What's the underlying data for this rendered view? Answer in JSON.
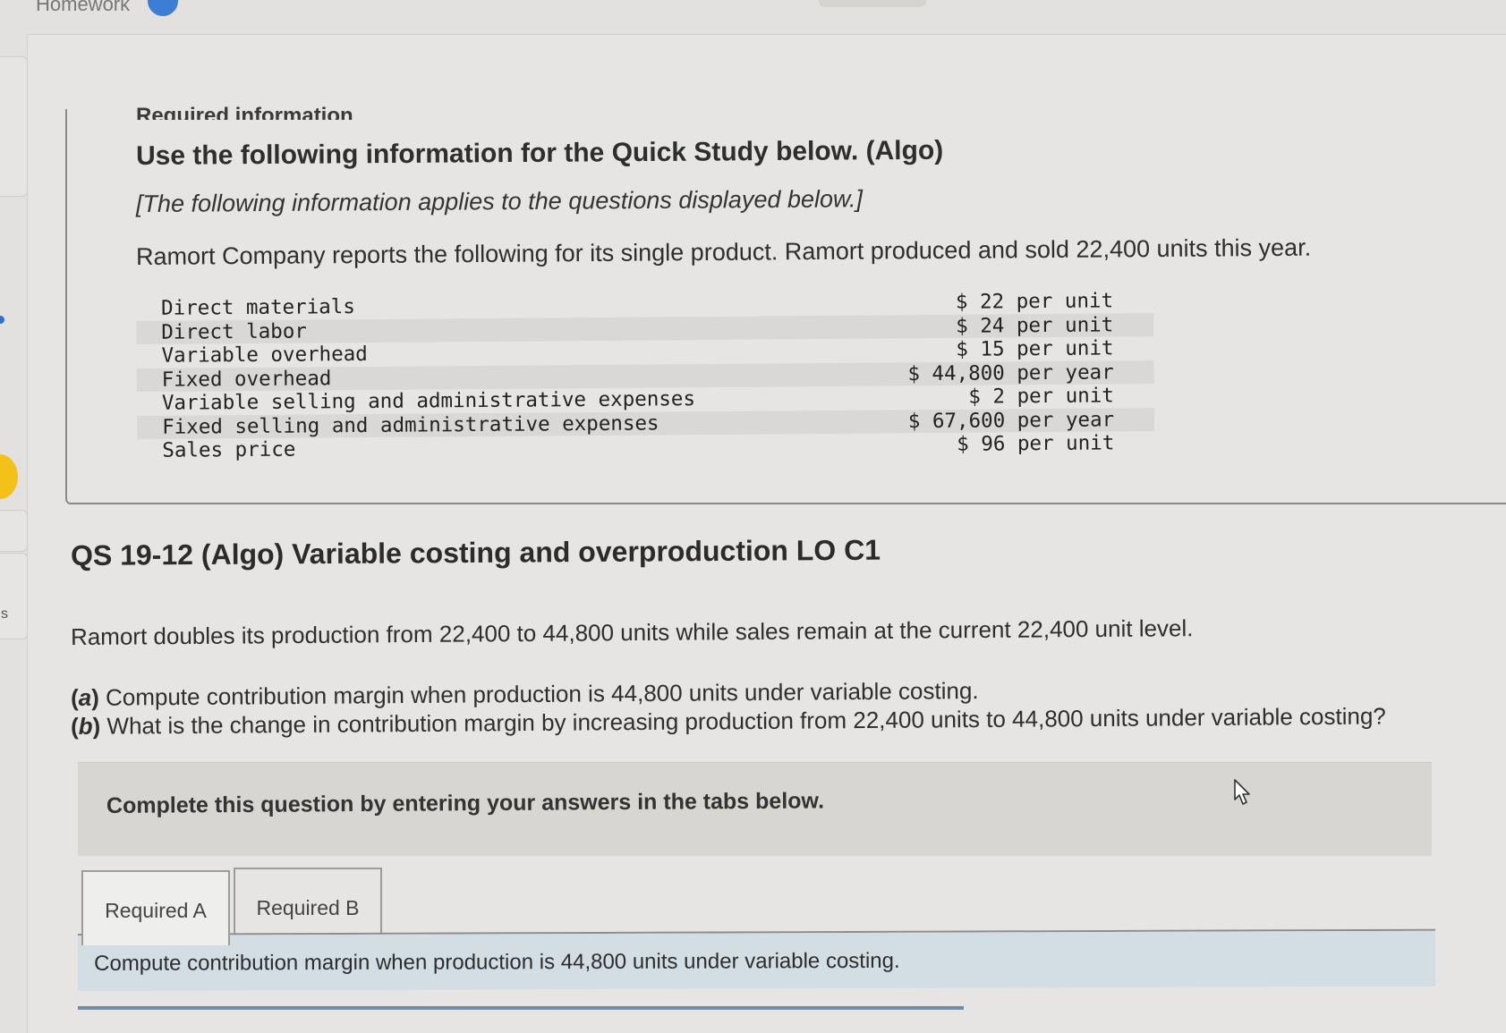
{
  "header": {
    "title": "Homework",
    "badge_icon": "info-icon"
  },
  "info_section": {
    "heading": "Required information",
    "title": "Use the following information for the Quick Study below. (Algo)",
    "note": "[The following information applies to the questions displayed below.]",
    "intro": "Ramort Company reports the following for its single product. Ramort produced and sold 22,400 units this year.",
    "cost_rows": [
      {
        "label": "Direct materials",
        "value": "$ 22 per unit"
      },
      {
        "label": "Direct labor",
        "value": "$ 24 per unit"
      },
      {
        "label": "Variable overhead",
        "value": "$ 15 per unit"
      },
      {
        "label": "Fixed overhead",
        "value": "$ 44,800 per year"
      },
      {
        "label": "Variable selling and administrative expenses",
        "value": "$ 2 per unit"
      },
      {
        "label": "Fixed selling and administrative expenses",
        "value": "$ 67,600 per year"
      },
      {
        "label": "Sales price",
        "value": "$ 96 per unit"
      }
    ]
  },
  "question": {
    "heading": "QS 19-12 (Algo) Variable costing and overproduction LO C1",
    "scenario": "Ramort doubles its production from 22,400 to 44,800 units while sales remain at the current 22,400 unit level.",
    "parts": [
      {
        "letter": "a",
        "text": "Compute contribution margin when production is 44,800 units under variable costing."
      },
      {
        "letter": "b",
        "text": "What is the change in contribution margin by increasing production from 22,400 units to 44,800 units under variable costing?"
      }
    ]
  },
  "answer_area": {
    "instruction": "Complete this question by entering your answers in the tabs below.",
    "tabs": [
      {
        "label": "Required A",
        "active": true
      },
      {
        "label": "Required B",
        "active": false
      }
    ],
    "prompt": "Compute contribution margin when production is 44,800 units under variable costing."
  },
  "sidebar": {
    "partial_letter": "s"
  },
  "colors": {
    "background": "#e6e5e3",
    "prompt_band": "#d2dde4",
    "instruction_band": "#d7d6d3",
    "accent_yellow": "#f3c117",
    "accent_blue": "#2f6fd0"
  }
}
